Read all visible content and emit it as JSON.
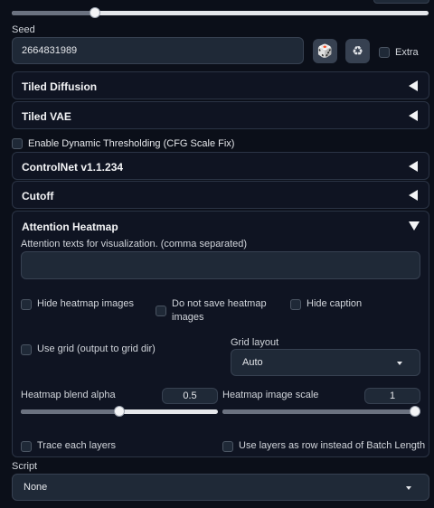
{
  "seed": {
    "label": "Seed",
    "value": "2664831989",
    "extra_label": "Extra",
    "dice_icon": "dice-icon",
    "recycle_icon": "recycle-icon"
  },
  "top_slider": {
    "value_fraction": 0.2
  },
  "tiled_diffusion": {
    "title": "Tiled Diffusion"
  },
  "tiled_vae": {
    "title": "Tiled VAE"
  },
  "dynamic_thresholding": {
    "label": "Enable Dynamic Thresholding (CFG Scale Fix)"
  },
  "controlnet": {
    "title": "ControlNet v1.1.234"
  },
  "cutoff": {
    "title": "Cutoff"
  },
  "attention_heatmap": {
    "title": "Attention Heatmap",
    "texts_label": "Attention texts for visualization. (comma separated)",
    "texts_value": "",
    "hide_images_label": "Hide heatmap images",
    "do_not_save_label_1": "Do not save heatmap",
    "do_not_save_label_2": "images",
    "hide_caption_label": "Hide caption",
    "use_grid_label": "Use grid (output to grid dir)",
    "grid_layout_label": "Grid layout",
    "grid_layout_value": "Auto",
    "blend_alpha_label": "Heatmap blend alpha",
    "blend_alpha_value": "0.5",
    "blend_alpha_fraction": 0.5,
    "image_scale_label": "Heatmap image scale",
    "image_scale_value": "1",
    "image_scale_fraction": 1.0,
    "trace_layers_label": "Trace each layers",
    "layers_as_row_label": "Use layers as row instead of Batch Length"
  },
  "script": {
    "label": "Script",
    "value": "None"
  },
  "colors": {
    "background": "#0b0f19",
    "panel": "#1f2937",
    "border": "#374151"
  }
}
